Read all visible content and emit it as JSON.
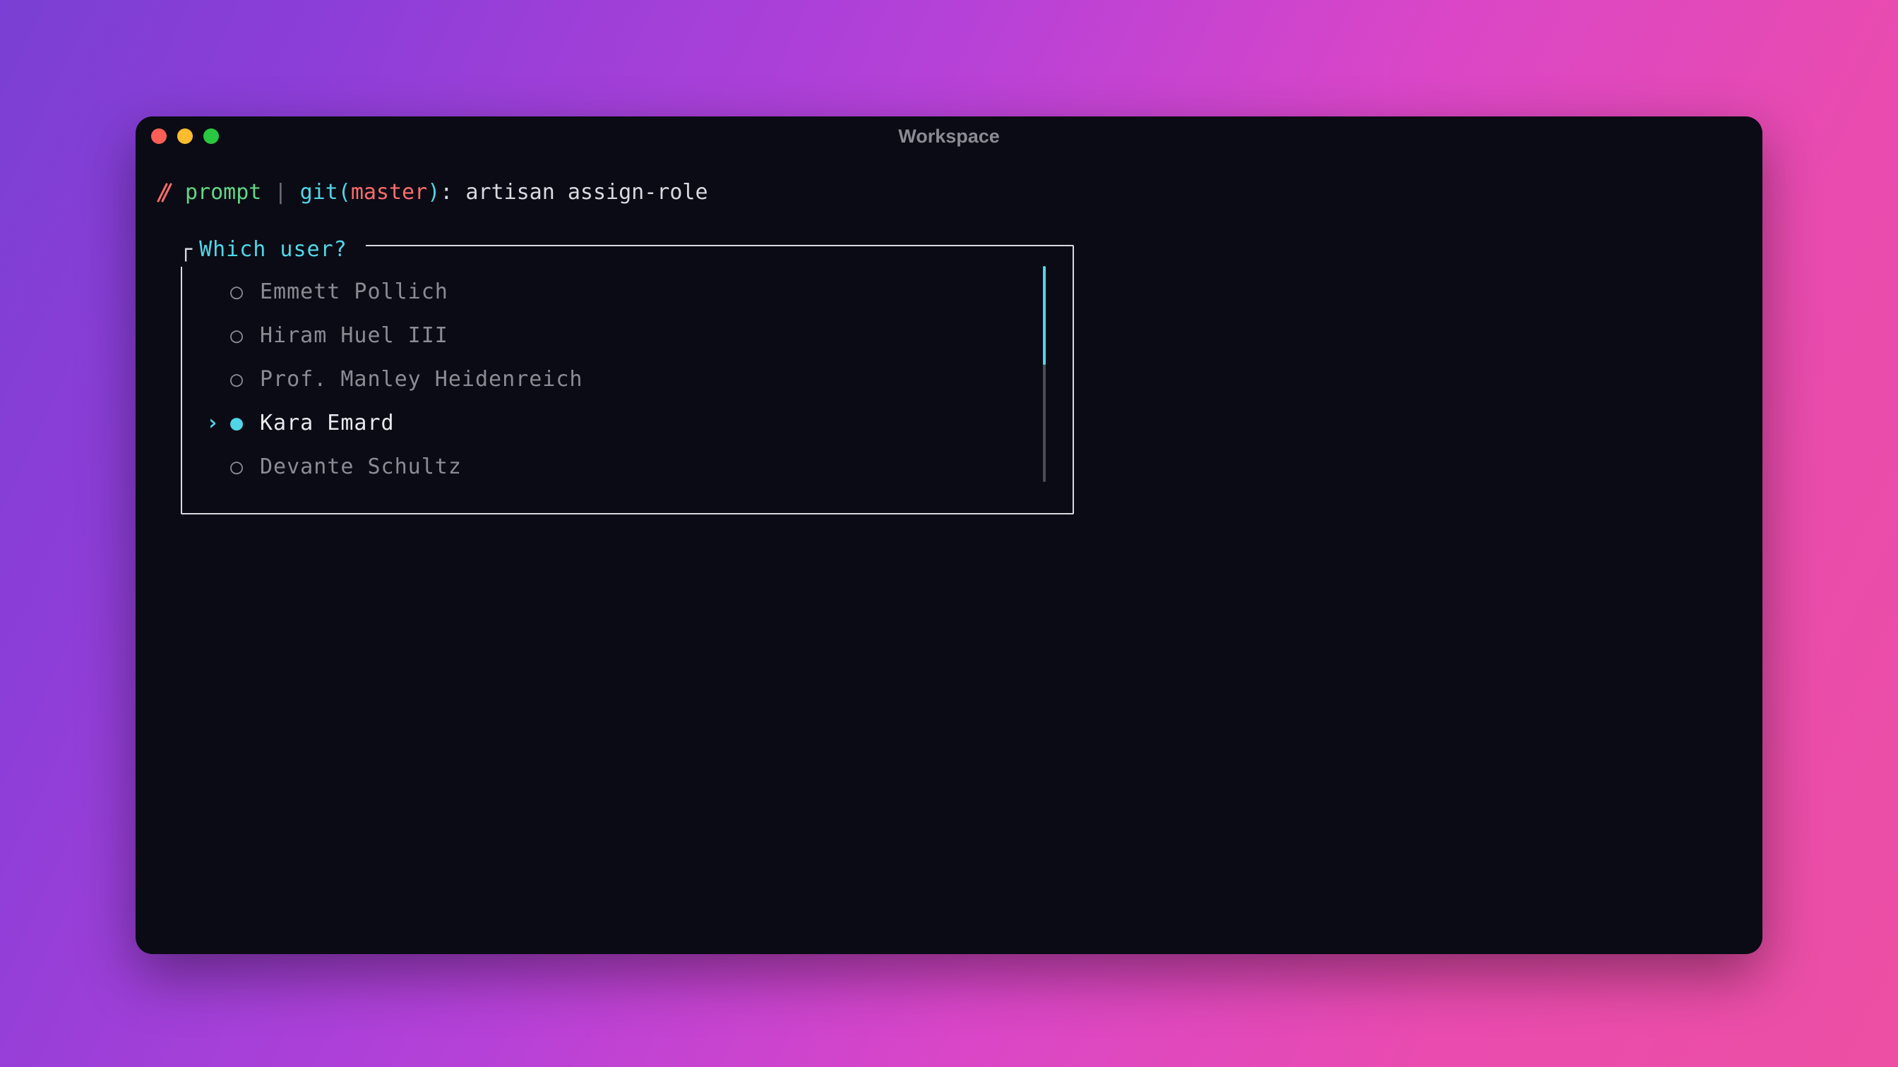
{
  "window": {
    "title": "Workspace"
  },
  "prompt": {
    "segment_prompt": "prompt",
    "pipe": " | ",
    "git_label": "git",
    "paren_open": "(",
    "branch": "master",
    "paren_close": ")",
    "colon": ": ",
    "command": "artisan assign-role"
  },
  "select": {
    "question": "Which user?",
    "selected_index": 3,
    "options": [
      {
        "label": "Emmett Pollich"
      },
      {
        "label": "Hiram Huel III"
      },
      {
        "label": "Prof. Manley Heidenreich"
      },
      {
        "label": "Kara Emard"
      },
      {
        "label": "Devante Schultz"
      }
    ]
  },
  "glyphs": {
    "pointer": "›",
    "radio_empty": "○",
    "radio_filled": "●",
    "legend_corner": "┌"
  }
}
